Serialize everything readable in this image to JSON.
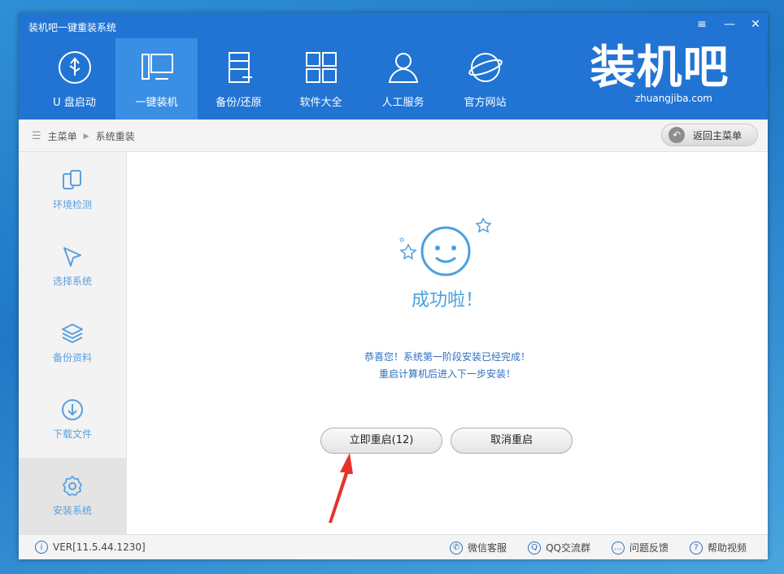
{
  "app": {
    "title": "装机吧一键重装系统"
  },
  "nav": {
    "items": [
      {
        "label": "U 盘启动",
        "icon": "usb-icon"
      },
      {
        "label": "一键装机",
        "icon": "monitor-icon",
        "active": true
      },
      {
        "label": "备份/还原",
        "icon": "backup-icon"
      },
      {
        "label": "软件大全",
        "icon": "apps-grid-icon"
      },
      {
        "label": "人工服务",
        "icon": "user-service-icon"
      },
      {
        "label": "官方网站",
        "icon": "globe-icon"
      }
    ]
  },
  "logo": {
    "text": "装机吧",
    "sub": "zhuangjiba.com"
  },
  "breadcrumb": {
    "home": "主菜单",
    "current": "系统重装"
  },
  "back_button": {
    "label": "返回主菜单"
  },
  "sidebar": {
    "items": [
      {
        "label": "环境检测",
        "icon": "device-check-icon"
      },
      {
        "label": "选择系统",
        "icon": "cursor-icon"
      },
      {
        "label": "备份资料",
        "icon": "layers-icon"
      },
      {
        "label": "下载文件",
        "icon": "download-icon"
      },
      {
        "label": "安装系统",
        "icon": "gear-icon",
        "active": true
      }
    ]
  },
  "main": {
    "success_title": "成功啦！",
    "message_line1": "恭喜您！系统第一阶段安装已经完成！",
    "message_line2": "重启计算机后进入下一步安装！",
    "restart_button": "立即重启(12)",
    "cancel_button": "取消重启"
  },
  "footer": {
    "version": "VER[11.5.44.1230]",
    "links": [
      {
        "label": "微信客服",
        "icon": "wechat-icon"
      },
      {
        "label": "QQ交流群",
        "icon": "qq-icon"
      },
      {
        "label": "问题反馈",
        "icon": "chat-icon"
      },
      {
        "label": "帮助视频",
        "icon": "help-icon"
      }
    ]
  },
  "colors": {
    "header": "#2174d3",
    "accent": "#4aa0e0",
    "arrow": "#e8312a"
  }
}
